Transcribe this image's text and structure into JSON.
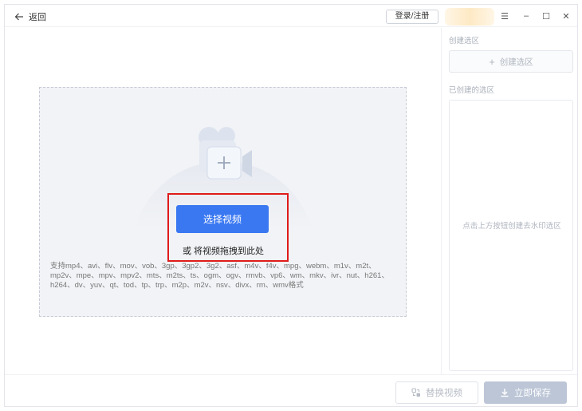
{
  "titlebar": {
    "back_label": "返回",
    "login_label": "登录/注册",
    "icons": {
      "back": "arrow-left-icon",
      "menu": "hamburger-menu-icon",
      "minimize": "minimize-icon",
      "maximize": "maximize-icon",
      "close": "close-icon"
    },
    "menu_glyph": "☰",
    "minimize_glyph": "–",
    "maximize_glyph": "☐",
    "close_glyph": "✕"
  },
  "upload": {
    "choose_button": "选择视频",
    "drag_hint": "或 将视频拖拽到此处",
    "formats_text": "支持mp4、avi、flv、mov、vob、3gp、3gp2、3g2、asf、m4v、f4v、mpg、webm、m1v、m2t、mp2v、mpe、mpv、mpv2、mts、m2ts、ts、ogm、ogv、rmvb、vp6、wm、mkv、ivr、nut、h261、h264、dv、yuv、qt、tod、tp、trp、m2p、m2v、nsv、divx、rm、wmv格式",
    "icon": "video-camera-add-icon"
  },
  "right_panel": {
    "create_section_label": "创建选区",
    "create_button": "创建选区",
    "created_section_label": "已创建的选区",
    "empty_hint": "点击上方按钮创建去水印选区"
  },
  "bottom": {
    "replace_button": "替换视频",
    "save_button": "立即保存"
  },
  "colors": {
    "primary": "#3a78f2",
    "disabled_save": "#bcc6d6",
    "highlight_border": "#e01b1b"
  }
}
